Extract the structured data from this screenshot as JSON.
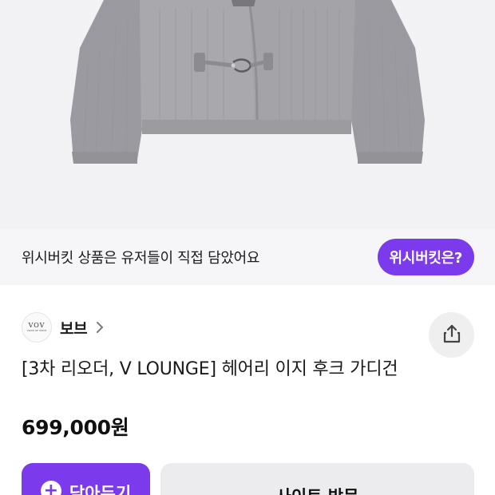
{
  "banner": {
    "text": "위시버킷 상품은 유저들이 직접 담았어요",
    "button_label": "위시버킷은?"
  },
  "brand": {
    "logo_text": "VOV",
    "logo_subtext": "VOICE OF VOICE",
    "name": "보브"
  },
  "product": {
    "title": "[3차 리오더, V LOUNGE] 헤어리 이지 후크 가디건",
    "price": "699,000원"
  },
  "actions": {
    "save_label": "담아두기",
    "visit_label": "사이트 방문"
  },
  "icons": {
    "share": "share-icon",
    "chevron": "chevron-right-icon",
    "plus": "plus-icon"
  },
  "colors": {
    "accent": "#7c3aed",
    "banner_bg": "#f6f6f8",
    "secondary_button_bg": "#ececee"
  }
}
